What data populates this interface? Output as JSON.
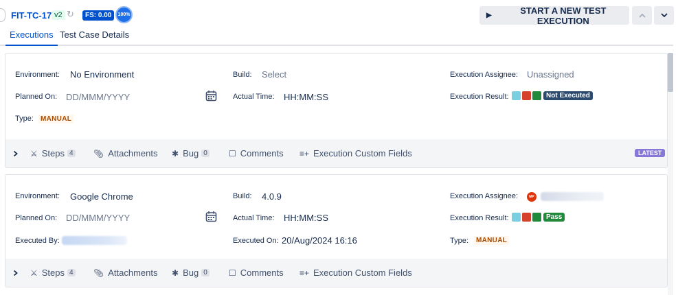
{
  "header": {
    "case_key": "FIT-TC-17",
    "version": "v2",
    "fs_badge": "FS: 0.00",
    "progress": "100%",
    "start_button": "START A NEW TEST EXECUTION"
  },
  "tabs": [
    {
      "label": "Executions",
      "active": true
    },
    {
      "label": "Test Case Details",
      "active": false
    }
  ],
  "executions": [
    {
      "environment_label": "Environment:",
      "environment": "No Environment",
      "build_label": "Build:",
      "build": "Select",
      "assignee_label": "Execution Assignee:",
      "assignee": "Unassigned",
      "planned_label": "Planned On:",
      "planned_placeholder": "DD/MMM/YYYY",
      "actual_time_label": "Actual Time:",
      "actual_time": "HH:MM:SS",
      "result_label": "Execution Result:",
      "result": "Not Executed",
      "result_color": "#2c4a6e",
      "type_label": "Type:",
      "type": "MANUAL",
      "footer": {
        "steps": "Steps",
        "steps_count": "4",
        "attachments": "Attachments",
        "bug": "Bug",
        "bug_count": "0",
        "comments": "Comments",
        "custom_fields": "Execution Custom Fields",
        "latest": "LATEST"
      }
    },
    {
      "environment_label": "Environment:",
      "environment": "Google Chrome",
      "build_label": "Build:",
      "build": "4.0.9",
      "assignee_label": "Execution Assignee:",
      "assignee_initials": "MP",
      "planned_label": "Planned On:",
      "planned_placeholder": "DD/MMM/YYYY",
      "actual_time_label": "Actual Time:",
      "actual_time": "HH:MM:SS",
      "result_label": "Execution Result:",
      "result": "Pass",
      "result_color": "#1f8a3b",
      "executed_by_label": "Executed By:",
      "executed_on_label": "Executed On:",
      "executed_on": "20/Aug/2024 16:16",
      "type_label": "Type:",
      "type": "MANUAL",
      "footer": {
        "steps": "Steps",
        "steps_count": "4",
        "attachments": "Attachments",
        "bug": "Bug",
        "bug_count": "0",
        "comments": "Comments",
        "custom_fields": "Execution Custom Fields"
      }
    }
  ],
  "result_square_colors": [
    "#79cfe0",
    "#d6412e",
    "#1f8a3b"
  ],
  "icons": {
    "sync": "sync-icon",
    "play": "play-icon",
    "calendar": "calendar-icon",
    "steps": "steps-icon",
    "attachment": "paperclip-icon",
    "bug": "bug-icon",
    "comment": "comment-icon",
    "custom_fields": "list-add-icon"
  }
}
